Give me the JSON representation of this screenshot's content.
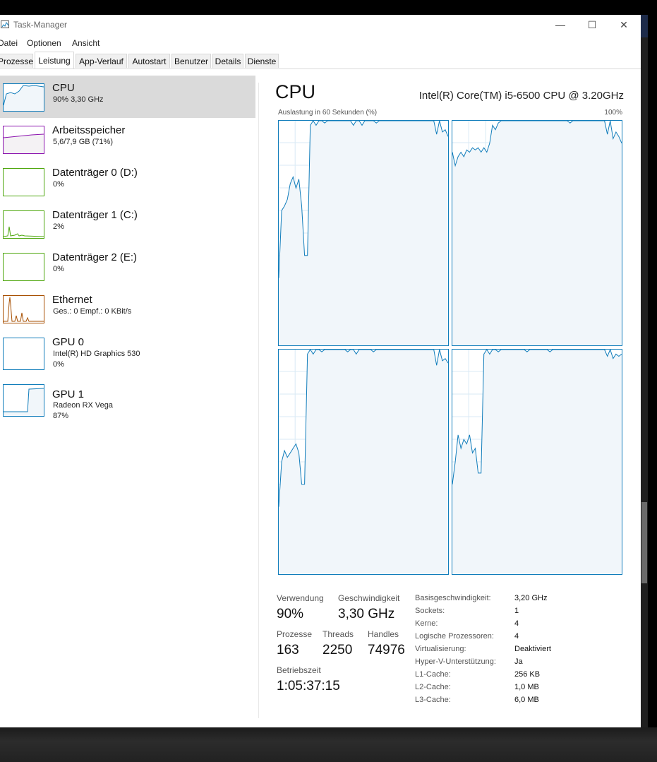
{
  "window": {
    "title": "Task-Manager",
    "controls": {
      "minimize": "—",
      "maximize": "☐",
      "close": "✕"
    }
  },
  "menu": [
    "Datei",
    "Optionen",
    "Ansicht"
  ],
  "tabs": [
    "Prozesse",
    "Leistung",
    "App-Verlauf",
    "Autostart",
    "Benutzer",
    "Details",
    "Dienste"
  ],
  "active_tab": "Leistung",
  "sidebar": [
    {
      "title": "CPU",
      "sub1": "90%  3,30 GHz",
      "sub2": "",
      "color": "#117dbb",
      "selected": true
    },
    {
      "title": "Arbeitsspeicher",
      "sub1": "5,6/7,9 GB (71%)",
      "sub2": "",
      "color": "#8b12ae",
      "selected": false
    },
    {
      "title": "Datenträger 0 (D:)",
      "sub1": "0%",
      "sub2": "",
      "color": "#4da60c",
      "selected": false
    },
    {
      "title": "Datenträger 1 (C:)",
      "sub1": "2%",
      "sub2": "",
      "color": "#4da60c",
      "selected": false
    },
    {
      "title": "Datenträger 2 (E:)",
      "sub1": "0%",
      "sub2": "",
      "color": "#4da60c",
      "selected": false
    },
    {
      "title": "Ethernet",
      "sub1": "Ges.: 0  Empf.: 0 KBit/s",
      "sub2": "",
      "color": "#a74f01",
      "selected": false
    },
    {
      "title": "GPU 0",
      "sub1": "Intel(R) HD Graphics 530",
      "sub2": "0%",
      "color": "#117dbb",
      "selected": false
    },
    {
      "title": "GPU 1",
      "sub1": "Radeon RX Vega",
      "sub2": "87%",
      "color": "#117dbb",
      "selected": false
    }
  ],
  "main": {
    "title": "CPU",
    "model": "Intel(R) Core(TM) i5-6500 CPU @ 3.20GHz",
    "graph_caption": "Auslastung in 60 Sekunden (%)",
    "graph_max": "100%",
    "graph_color": "#117dbb"
  },
  "stats": {
    "verwendung_label": "Verwendung",
    "verwendung": "90%",
    "geschwindigkeit_label": "Geschwindigkeit",
    "geschwindigkeit": "3,30 GHz",
    "prozesse_label": "Prozesse",
    "prozesse": "163",
    "threads_label": "Threads",
    "threads": "2250",
    "handles_label": "Handles",
    "handles": "74976",
    "betriebszeit_label": "Betriebszeit",
    "betriebszeit": "1:05:37:15"
  },
  "info": [
    {
      "k": "Basisgeschwindigkeit:",
      "v": "3,20 GHz"
    },
    {
      "k": "Sockets:",
      "v": "1"
    },
    {
      "k": "Kerne:",
      "v": "4"
    },
    {
      "k": "Logische Prozessoren:",
      "v": "4"
    },
    {
      "k": "Virtualisierung:",
      "v": "Deaktiviert"
    },
    {
      "k": "Hyper-V-Unterstützung:",
      "v": "Ja"
    },
    {
      "k": "L1-Cache:",
      "v": "256 KB"
    },
    {
      "k": "L2-Cache:",
      "v": "1,0 MB"
    },
    {
      "k": "L3-Cache:",
      "v": "6,0 MB"
    }
  ],
  "chart_data": {
    "type": "line",
    "title": "Auslastung in 60 Sekunden (%)",
    "ylim": [
      0,
      100
    ],
    "x_points": 60,
    "series": [
      {
        "values": [
          30,
          60,
          62,
          65,
          72,
          75,
          70,
          74,
          62,
          40,
          40,
          98,
          100,
          98,
          100,
          100,
          99,
          100,
          100,
          100,
          100,
          100,
          100,
          100,
          100,
          100,
          98,
          100,
          100,
          98,
          100,
          100,
          100,
          100,
          99,
          100,
          100,
          100,
          100,
          100,
          100,
          100,
          100,
          100,
          100,
          100,
          100,
          100,
          100,
          100,
          100,
          100,
          100,
          100,
          100,
          94,
          100,
          95,
          96,
          93
        ]
      },
      {
        "values": [
          86,
          80,
          84,
          86,
          84,
          87,
          86,
          88,
          87,
          88,
          86,
          88,
          86,
          90,
          98,
          96,
          99,
          100,
          100,
          100,
          100,
          100,
          100,
          100,
          100,
          100,
          100,
          100,
          100,
          100,
          100,
          100,
          100,
          100,
          100,
          100,
          100,
          100,
          100,
          100,
          100,
          99,
          100,
          100,
          100,
          100,
          100,
          100,
          100,
          100,
          100,
          100,
          100,
          100,
          94,
          100,
          92,
          95,
          93,
          90
        ]
      },
      {
        "values": [
          30,
          50,
          55,
          52,
          54,
          56,
          58,
          54,
          40,
          40,
          98,
          100,
          98,
          100,
          100,
          99,
          100,
          100,
          100,
          100,
          100,
          100,
          100,
          100,
          99,
          100,
          100,
          98,
          100,
          100,
          100,
          100,
          100,
          99,
          100,
          100,
          100,
          100,
          100,
          100,
          100,
          100,
          100,
          100,
          100,
          100,
          100,
          100,
          100,
          100,
          100,
          100,
          100,
          100,
          100,
          93,
          100,
          95,
          96,
          94
        ]
      },
      {
        "values": [
          40,
          50,
          62,
          56,
          60,
          58,
          62,
          54,
          56,
          45,
          45,
          98,
          100,
          98,
          100,
          100,
          99,
          100,
          100,
          100,
          100,
          100,
          100,
          100,
          100,
          100,
          99,
          100,
          100,
          100,
          100,
          100,
          100,
          100,
          99,
          100,
          100,
          100,
          100,
          100,
          100,
          100,
          100,
          100,
          100,
          100,
          100,
          100,
          100,
          100,
          100,
          100,
          100,
          100,
          97,
          100,
          96,
          98,
          97,
          98
        ]
      }
    ]
  }
}
